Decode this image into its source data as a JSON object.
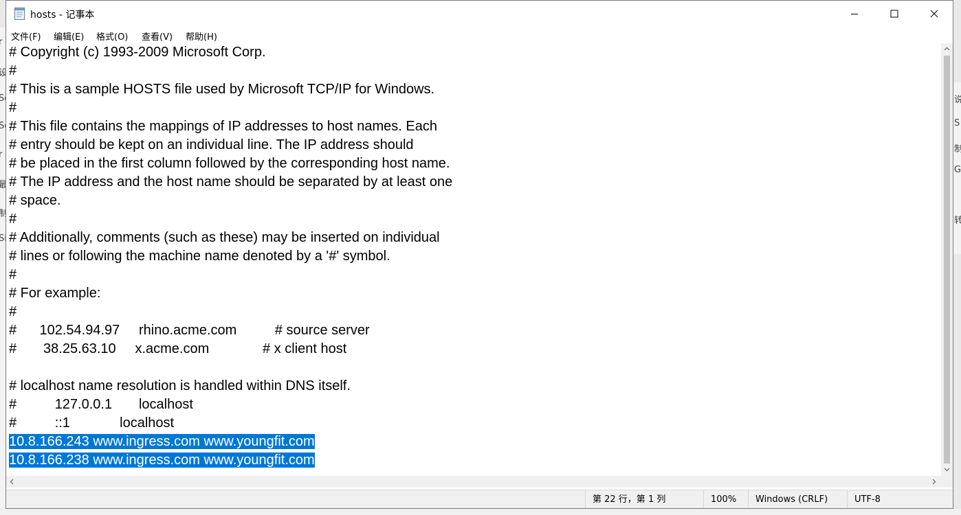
{
  "window": {
    "title": "hosts - 记事本",
    "icon": "notepad-icon",
    "controls": [
      "minimize-icon",
      "maximize-icon",
      "close-icon"
    ]
  },
  "menu": [
    {
      "label": "文件(F)"
    },
    {
      "label": "编辑(E)"
    },
    {
      "label": "格式(O)"
    },
    {
      "label": "查看(V)"
    },
    {
      "label": "帮助(H)"
    }
  ],
  "editor": {
    "lines": [
      "# Copyright (c) 1993-2009 Microsoft Corp.",
      "#",
      "# This is a sample HOSTS file used by Microsoft TCP/IP for Windows.",
      "#",
      "# This file contains the mappings of IP addresses to host names. Each",
      "# entry should be kept on an individual line. The IP address should",
      "# be placed in the first column followed by the corresponding host name.",
      "# The IP address and the host name should be separated by at least one",
      "# space.",
      "#",
      "# Additionally, comments (such as these) may be inserted on individual",
      "# lines or following the machine name denoted by a '#' symbol.",
      "#",
      "# For example:",
      "#",
      "#      102.54.94.97     rhino.acme.com          # source server",
      "#       38.25.63.10     x.acme.com              # x client host",
      "",
      "# localhost name resolution is handled within DNS itself.",
      "#\t127.0.0.1       localhost",
      "#\t::1             localhost",
      "10.8.166.243 www.ingress.com www.youngfit.com",
      "10.8.166.238 www.ingress.com www.youngfit.com"
    ],
    "selected_lines": [
      21,
      22
    ],
    "selection_color": "#0078d7"
  },
  "status": {
    "position": "第 22 行，第 1 列",
    "zoom": "100%",
    "line_ending": "Windows (CRLF)",
    "encoding": "UTF-8"
  }
}
